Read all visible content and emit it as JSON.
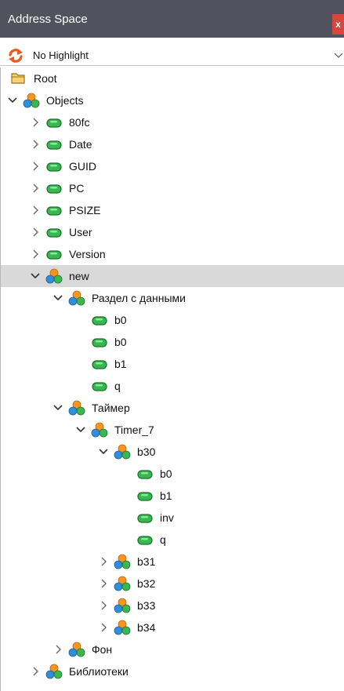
{
  "panel": {
    "title": "Address Space",
    "close_label": "x"
  },
  "toolbar": {
    "highlight_value": "No Highlight"
  },
  "tree": [
    {
      "label": "Root",
      "level": 0,
      "icon": "folder",
      "toggle": "none"
    },
    {
      "label": "Objects",
      "level": 0,
      "icon": "object",
      "toggle": "expanded"
    },
    {
      "label": "80fc",
      "level": 1,
      "icon": "variable",
      "toggle": "collapsed"
    },
    {
      "label": "Date",
      "level": 1,
      "icon": "variable",
      "toggle": "collapsed"
    },
    {
      "label": "GUID",
      "level": 1,
      "icon": "variable",
      "toggle": "collapsed"
    },
    {
      "label": "PC",
      "level": 1,
      "icon": "variable",
      "toggle": "collapsed"
    },
    {
      "label": "PSIZE",
      "level": 1,
      "icon": "variable",
      "toggle": "collapsed"
    },
    {
      "label": "User",
      "level": 1,
      "icon": "variable",
      "toggle": "collapsed"
    },
    {
      "label": "Version",
      "level": 1,
      "icon": "variable",
      "toggle": "collapsed"
    },
    {
      "label": "new",
      "level": 1,
      "icon": "object",
      "toggle": "expanded",
      "selected": true
    },
    {
      "label": "Раздел с данными",
      "level": 2,
      "icon": "object",
      "toggle": "expanded"
    },
    {
      "label": "b0",
      "level": 3,
      "icon": "variable",
      "toggle": "none"
    },
    {
      "label": "b0",
      "level": 3,
      "icon": "variable",
      "toggle": "none"
    },
    {
      "label": "b1",
      "level": 3,
      "icon": "variable",
      "toggle": "none"
    },
    {
      "label": "q",
      "level": 3,
      "icon": "variable",
      "toggle": "none"
    },
    {
      "label": "Таймер",
      "level": 2,
      "icon": "object",
      "toggle": "expanded"
    },
    {
      "label": "Timer_7",
      "level": 3,
      "icon": "object",
      "toggle": "expanded"
    },
    {
      "label": "b30",
      "level": 4,
      "icon": "object",
      "toggle": "expanded"
    },
    {
      "label": "b0",
      "level": 5,
      "icon": "variable",
      "toggle": "none"
    },
    {
      "label": "b1",
      "level": 5,
      "icon": "variable",
      "toggle": "none"
    },
    {
      "label": "inv",
      "level": 5,
      "icon": "variable",
      "toggle": "none"
    },
    {
      "label": "q",
      "level": 5,
      "icon": "variable",
      "toggle": "none"
    },
    {
      "label": "b31",
      "level": 4,
      "icon": "object",
      "toggle": "collapsed"
    },
    {
      "label": "b32",
      "level": 4,
      "icon": "object",
      "toggle": "collapsed"
    },
    {
      "label": "b33",
      "level": 4,
      "icon": "object",
      "toggle": "collapsed"
    },
    {
      "label": "b34",
      "level": 4,
      "icon": "object",
      "toggle": "collapsed"
    },
    {
      "label": "Фон",
      "level": 2,
      "icon": "object",
      "toggle": "collapsed"
    },
    {
      "label": "Библиотеки",
      "level": 1,
      "icon": "object",
      "toggle": "collapsed"
    }
  ]
}
